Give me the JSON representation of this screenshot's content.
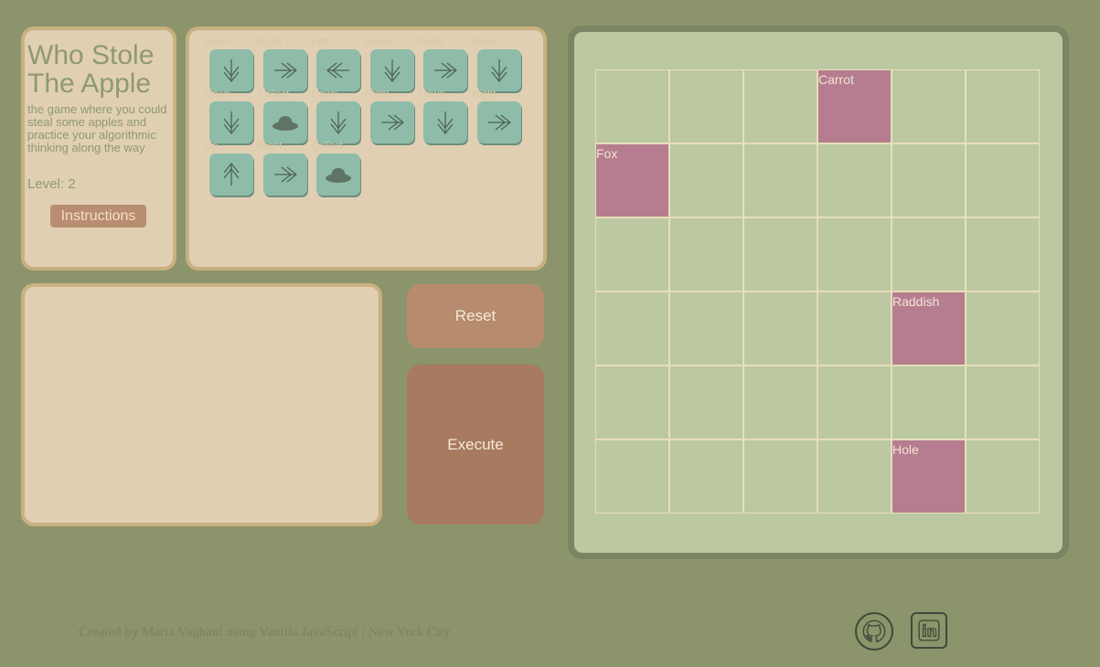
{
  "info": {
    "title": "Who Stole The Apple",
    "subtitle": "the game where you could steal some apples and practice your algorithmic thinking along the way",
    "level": "Level: 2",
    "instructions_label": "Instructions"
  },
  "commands": [
    {
      "label": "Down",
      "icon": "arrow-down-icon"
    },
    {
      "label": "Right",
      "icon": "arrow-right-icon"
    },
    {
      "label": "Left",
      "icon": "arrow-left-icon"
    },
    {
      "label": "Down",
      "icon": "arrow-down-icon"
    },
    {
      "label": "Right",
      "icon": "arrow-right-icon"
    },
    {
      "label": "Down",
      "icon": "arrow-down-icon"
    },
    {
      "label": "Down",
      "icon": "arrow-down-icon"
    },
    {
      "label": "Collect",
      "icon": "hat-icon"
    },
    {
      "label": "Down",
      "icon": "arrow-down-icon"
    },
    {
      "label": "Right",
      "icon": "arrow-right-icon"
    },
    {
      "label": "Down",
      "icon": "arrow-down-icon"
    },
    {
      "label": "Right",
      "icon": "arrow-right-icon"
    },
    {
      "label": "Up",
      "icon": "arrow-up-icon"
    },
    {
      "label": "Right",
      "icon": "arrow-right-icon"
    },
    {
      "label": "Collect",
      "icon": "hat-icon"
    }
  ],
  "controls": {
    "reset_label": "Reset",
    "execute_label": "Execute"
  },
  "board": {
    "rows": 6,
    "cols": 6,
    "items": [
      {
        "name": "Carrot",
        "row": 0,
        "col": 3
      },
      {
        "name": "Fox",
        "row": 1,
        "col": 0
      },
      {
        "name": "Raddish",
        "row": 3,
        "col": 4
      },
      {
        "name": "Hole",
        "row": 5,
        "col": 4
      }
    ]
  },
  "footer": {
    "credit": "Created by Maria Vaghani using Vanilla JavaScript | New York City"
  },
  "social": [
    {
      "name": "github-icon"
    },
    {
      "name": "linkedin-icon"
    }
  ],
  "colors": {
    "background": "#8c946b",
    "panel": "#e1cfb4",
    "tile": "#8ebca8",
    "board": "#bcc8a2",
    "item": "#b57d8f"
  }
}
